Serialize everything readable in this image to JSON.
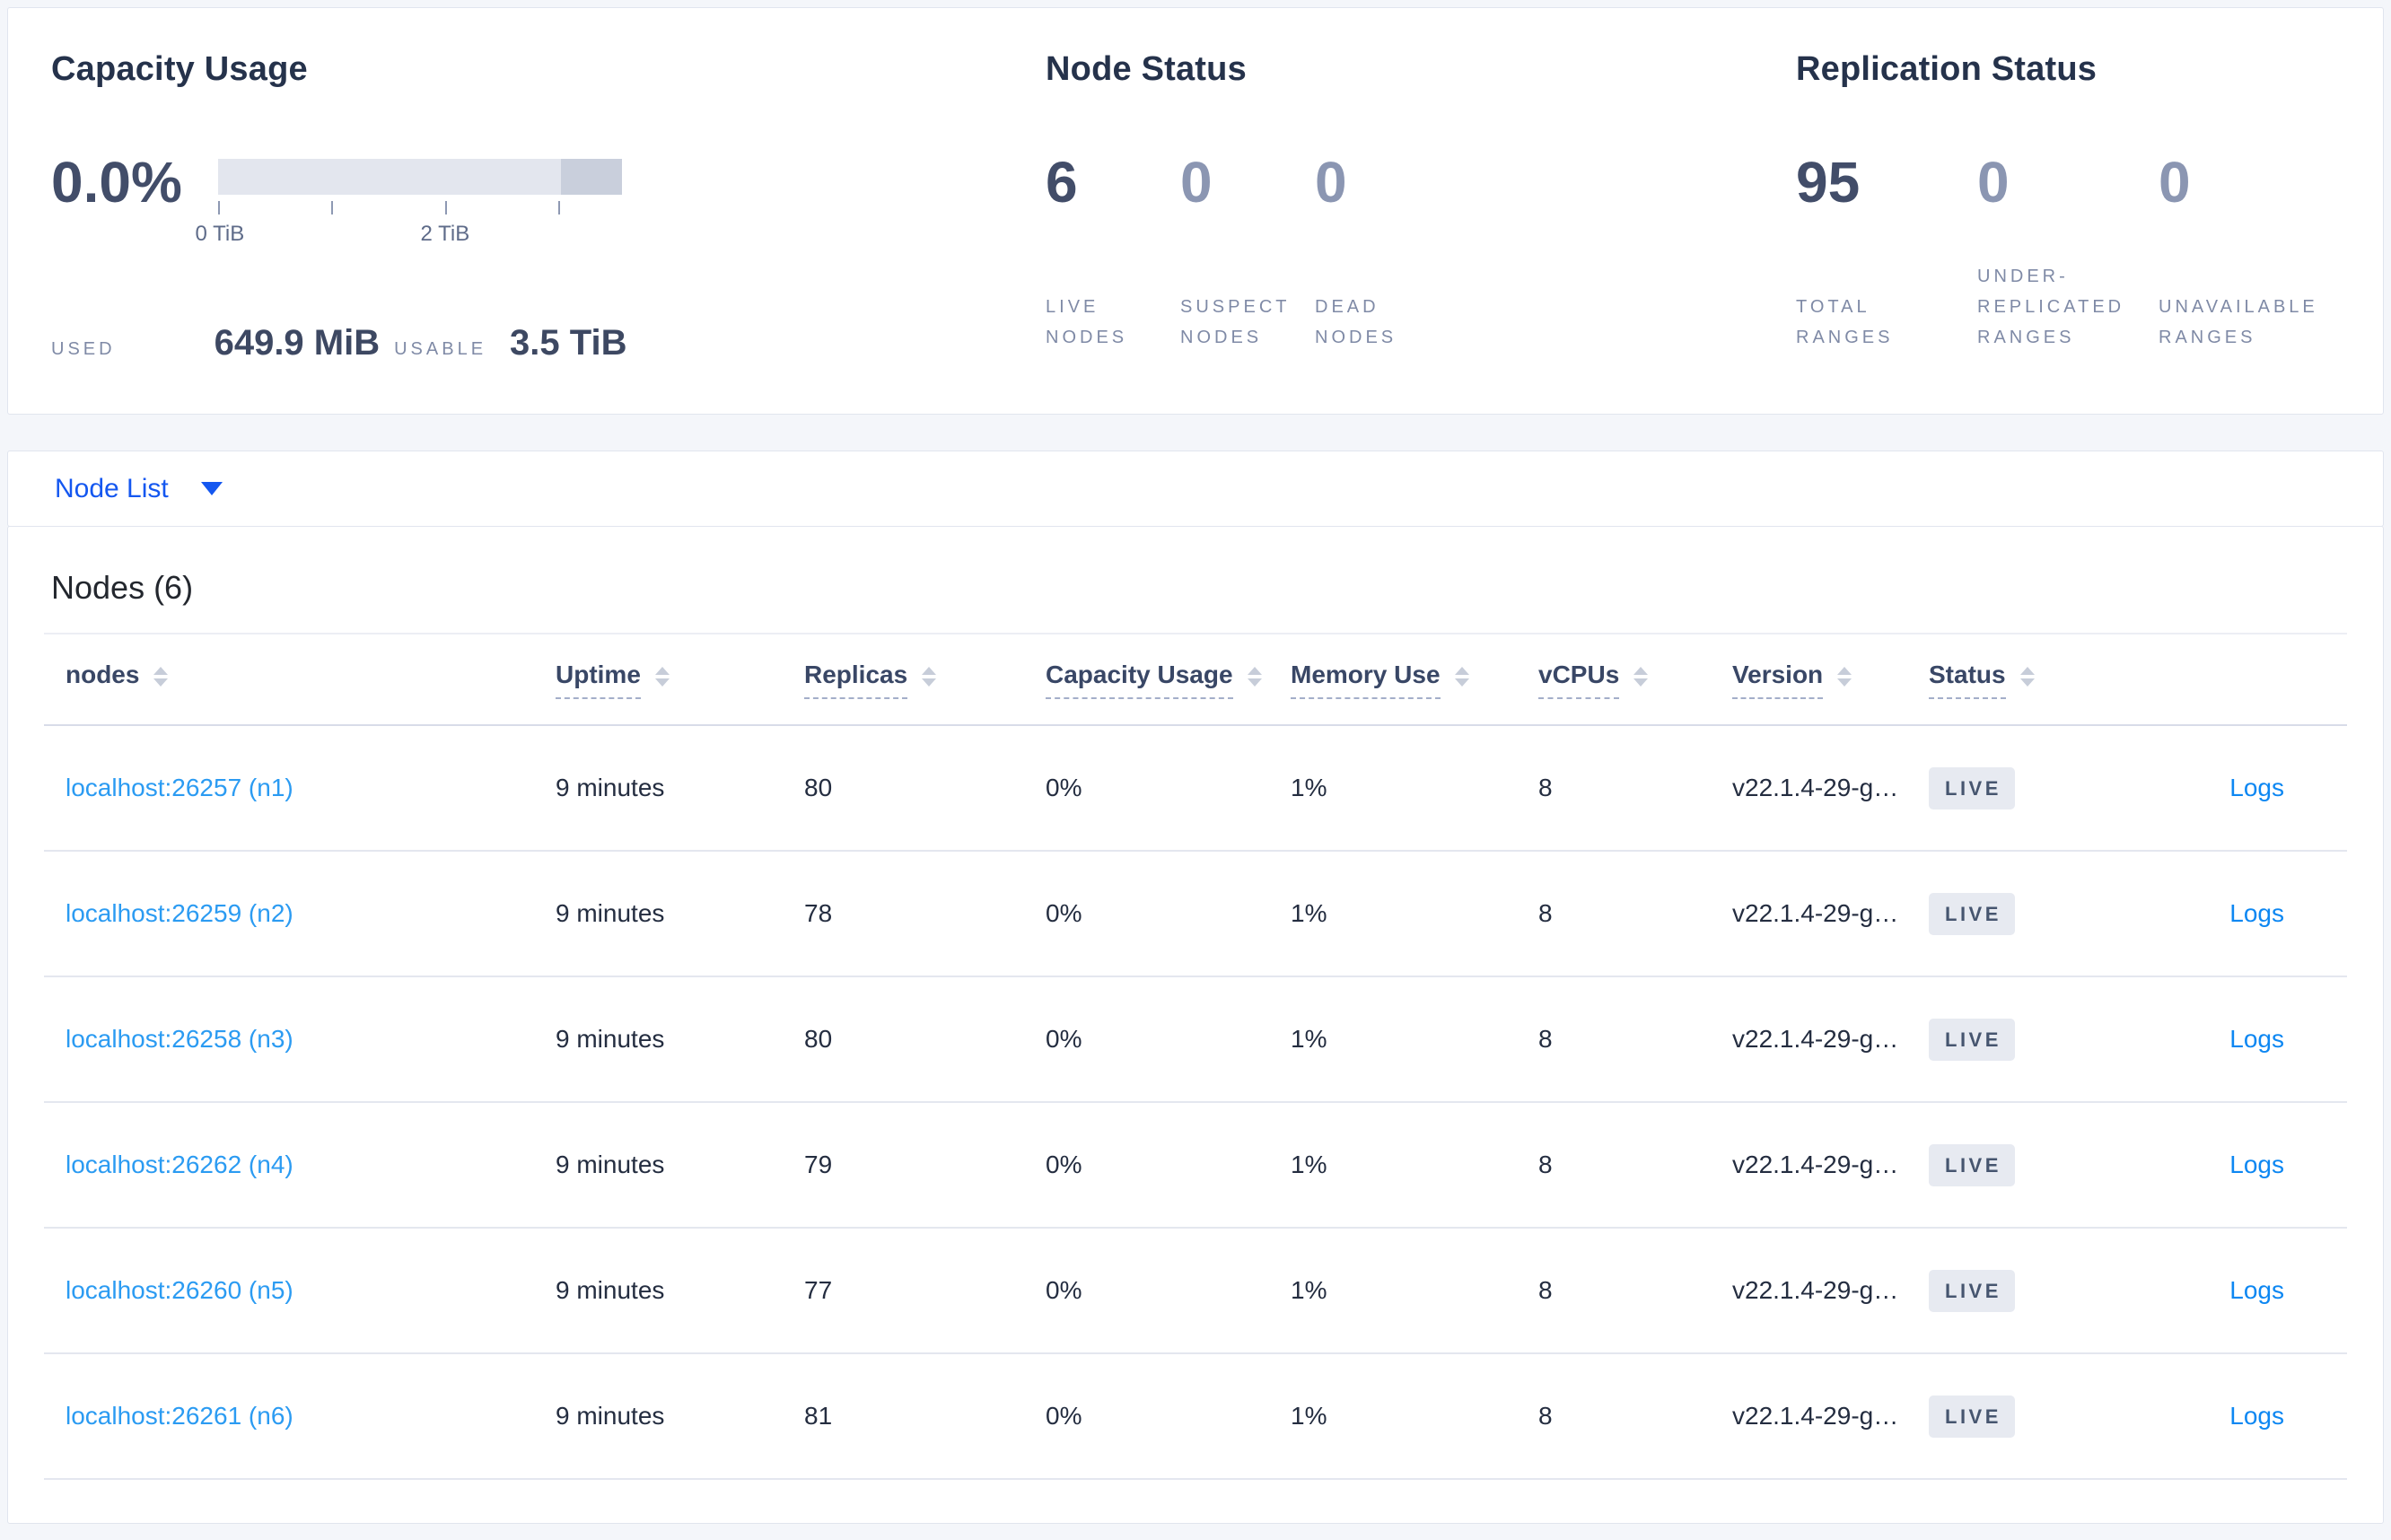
{
  "capacity_card": {
    "title": "Capacity Usage",
    "percent": "0.0%",
    "axis": {
      "tick0_label": "0 TiB",
      "tick2_label": "2 TiB"
    },
    "used_label": "USED",
    "used_value": "649.9 MiB",
    "usable_label": "USABLE",
    "usable_value": "3.5 TiB"
  },
  "node_status_card": {
    "title": "Node Status",
    "stats": [
      {
        "value": "6",
        "label": "LIVE NODES"
      },
      {
        "value": "0",
        "label": "SUSPECT NODES"
      },
      {
        "value": "0",
        "label": "DEAD NODES"
      }
    ]
  },
  "replication_card": {
    "title": "Replication Status",
    "stats": [
      {
        "value": "95",
        "label": "TOTAL RANGES"
      },
      {
        "value": "0",
        "label": "UNDER-REPLICATED RANGES"
      },
      {
        "value": "0",
        "label": "UNAVAILABLE RANGES"
      }
    ]
  },
  "node_list": {
    "view_selector_label": "Node List",
    "heading": "Nodes (6)",
    "logs_label": "Logs",
    "columns": [
      {
        "label": "nodes"
      },
      {
        "label": "Uptime"
      },
      {
        "label": "Replicas"
      },
      {
        "label": "Capacity Usage"
      },
      {
        "label": "Memory Use"
      },
      {
        "label": "vCPUs"
      },
      {
        "label": "Version"
      },
      {
        "label": "Status"
      }
    ],
    "rows": [
      {
        "node": "localhost:26257 (n1)",
        "uptime": "9 minutes",
        "replicas": "80",
        "capacity_usage": "0%",
        "memory_use": "1%",
        "vcpus": "8",
        "version": "v22.1.4-29-g…",
        "status": "LIVE"
      },
      {
        "node": "localhost:26259 (n2)",
        "uptime": "9 minutes",
        "replicas": "78",
        "capacity_usage": "0%",
        "memory_use": "1%",
        "vcpus": "8",
        "version": "v22.1.4-29-g…",
        "status": "LIVE"
      },
      {
        "node": "localhost:26258 (n3)",
        "uptime": "9 minutes",
        "replicas": "80",
        "capacity_usage": "0%",
        "memory_use": "1%",
        "vcpus": "8",
        "version": "v22.1.4-29-g…",
        "status": "LIVE"
      },
      {
        "node": "localhost:26262 (n4)",
        "uptime": "9 minutes",
        "replicas": "79",
        "capacity_usage": "0%",
        "memory_use": "1%",
        "vcpus": "8",
        "version": "v22.1.4-29-g…",
        "status": "LIVE"
      },
      {
        "node": "localhost:26260 (n5)",
        "uptime": "9 minutes",
        "replicas": "77",
        "capacity_usage": "0%",
        "memory_use": "1%",
        "vcpus": "8",
        "version": "v22.1.4-29-g…",
        "status": "LIVE"
      },
      {
        "node": "localhost:26261 (n6)",
        "uptime": "9 minutes",
        "replicas": "81",
        "capacity_usage": "0%",
        "memory_use": "1%",
        "vcpus": "8",
        "version": "v22.1.4-29-g…",
        "status": "LIVE"
      }
    ]
  },
  "colors": {
    "accent_blue": "#1457f0",
    "node_link_blue": "#2b9bf2",
    "logs_link_blue": "#0d87f2",
    "badge_bg": "#e7eaf1",
    "bar_light": "#e3e6ee",
    "bar_dark": "#c9cfdc",
    "page_bg": "#f4f6fa"
  }
}
